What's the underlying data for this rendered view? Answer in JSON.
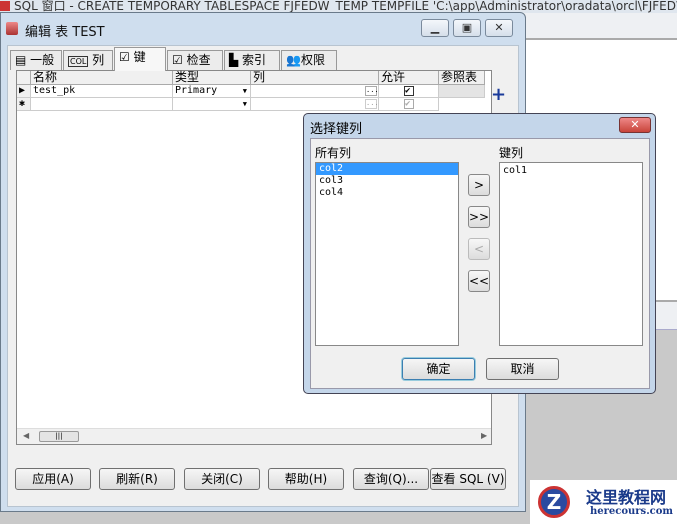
{
  "background": {
    "title": "SQL 窗口 - CREATE TEMPORARY TABLESPACE FJFEDW_TEMP TEMPFILE 'C:\\app\\Administrator\\oradata\\orcl\\FJFEDW"
  },
  "edit_window": {
    "title": "编辑 表 TEST",
    "tabs": [
      {
        "label": "一般",
        "icon": "form-icon"
      },
      {
        "label": "列",
        "icon": "col-icon"
      },
      {
        "label": "键",
        "icon": "key-check-icon",
        "active": true
      },
      {
        "label": "检查",
        "icon": "check-icon"
      },
      {
        "label": "索引",
        "icon": "index-icon"
      },
      {
        "label": "权限",
        "icon": "users-icon"
      }
    ],
    "columns": [
      "名称",
      "类型",
      "列",
      "允许",
      "参照表"
    ],
    "rows": [
      {
        "name": "test_pk",
        "type": "Primary",
        "column": "",
        "enabled": true,
        "ref_table": ""
      },
      {
        "name": "",
        "type": "",
        "column": "",
        "enabled": true,
        "ref_table": ""
      }
    ],
    "row_markers": [
      "▶",
      "✱"
    ],
    "side_buttons": {
      "add": "+",
      "remove": "−"
    },
    "buttons": [
      "应用(A)",
      "刷新(R)",
      "关闭(C)",
      "帮助(H)",
      "查询(Q)...",
      "查看 SQL (V)"
    ]
  },
  "dialog": {
    "title": "选择键列",
    "all_label": "所有列",
    "key_label": "键列",
    "all_columns": [
      "col2",
      "col3",
      "col4"
    ],
    "selected_index": 0,
    "key_columns": [
      "col1"
    ],
    "move_buttons": [
      ">",
      ">>",
      "<",
      "<<"
    ],
    "ok": "确定",
    "cancel": "取消"
  },
  "watermark": {
    "name": "这里教程网",
    "url": "herecours.com"
  },
  "colors": {
    "selection": "#3399ff",
    "close_red": "#c8443a",
    "window_frame": "#cfdeee"
  }
}
